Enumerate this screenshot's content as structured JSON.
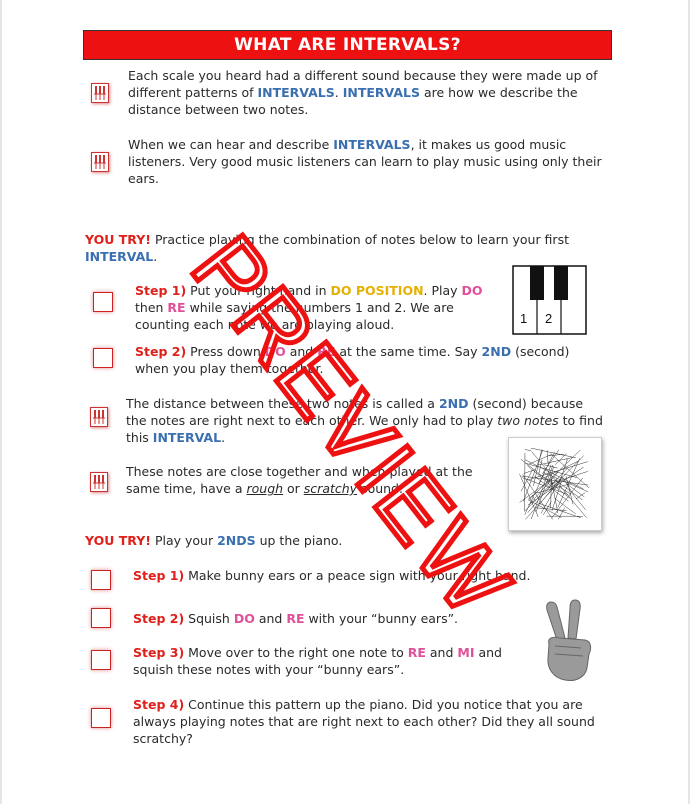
{
  "title": "WHAT ARE INTERVALS?",
  "intro": {
    "p1": {
      "a": "Each scale you heard had a different sound because they were made up of different patterns of ",
      "k1": "INTERVALS",
      "b": ". ",
      "k2": "INTERVALS",
      "c": " are how we describe the distance between two notes."
    },
    "p2": {
      "a": "When we can hear and describe ",
      "k1": "INTERVALS",
      "b": ", it makes us good music listeners. Very good music listeners can learn to play music using only their ears."
    }
  },
  "try1": {
    "lead": "YOU TRY!",
    "a": " Practice playing the combination of notes below to learn your first ",
    "k": "INTERVAL",
    "b": "."
  },
  "step1": {
    "label": "Step 1)",
    "a": " Put your right hand in ",
    "pos": "DO POSITION",
    "b": ". Play ",
    "do": "DO",
    "c": " then ",
    "re": "RE",
    "d": " while saying the numbers 1 and 2. We are counting each note we are playing aloud."
  },
  "step2": {
    "label": "Step 2)",
    "a": " Press down ",
    "do": "DO",
    "b": " and ",
    "re": "RE",
    "c": " at the same time. Say ",
    "k": "2ND",
    "d": " (second) when you play them together."
  },
  "keys": {
    "n1": "1",
    "n2": "2"
  },
  "para3": {
    "a": "The distance between these two notes is called a ",
    "k1": "2ND",
    "b": " (second) because the notes are right next to each other. We only had to play ",
    "em": "two notes",
    "c": " to find this ",
    "k2": "INTERVAL",
    "d": "."
  },
  "para4": {
    "a": "These notes are close together and when played at the same time, have a ",
    "u1": "rough",
    "b": " or ",
    "u2": "scratchy",
    "c": " sound."
  },
  "try2": {
    "lead": "YOU TRY!",
    "a": " Play your ",
    "k": "2NDS",
    "b": " up the piano."
  },
  "s1": {
    "label": "Step 1)",
    "a": " Make bunny ears or a peace sign with your right hand."
  },
  "s2": {
    "label": "Step 2)",
    "a": " Squish ",
    "do": "DO",
    "b": " and ",
    "re": "RE",
    "c": " with your “bunny ears”."
  },
  "s3": {
    "label": "Step 3)",
    "a": " Move over to the right one note to ",
    "re": "RE",
    "b": " and ",
    "mi": "MI",
    "c": " and squish these notes with your “bunny ears”."
  },
  "s4": {
    "label": "Step 4)",
    "a": " Continue this pattern up the piano. Did you notice that you are always playing notes that are right next to each other? Did they all sound scratchy?"
  },
  "watermark": "PREVIEW",
  "colors": {
    "banner": "#ee1111",
    "keyword_blue": "#3a6fb0",
    "note_pink": "#e0509a",
    "position_yellow": "#e6b000",
    "label_red": "#e0201a"
  }
}
